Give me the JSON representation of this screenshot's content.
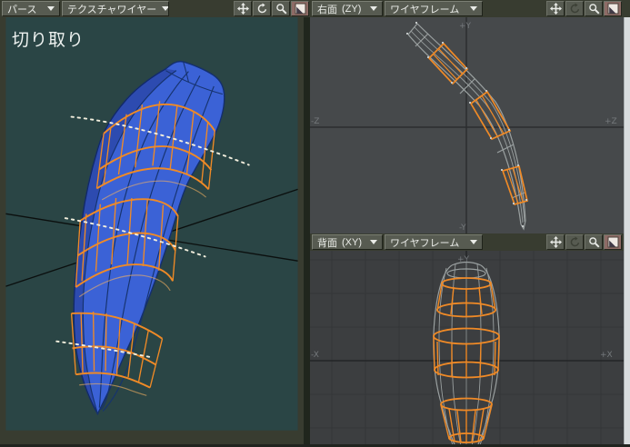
{
  "window": {
    "overlay_text": "切り取り"
  },
  "viewports": {
    "perspective": {
      "view_label": "パース",
      "display_mode": "テクスチャワイヤー"
    },
    "right": {
      "view_label": "右面",
      "axis_label": "(ZY)",
      "display_mode": "ワイヤフレーム",
      "axes": {
        "top": "+Y",
        "bottom": "-Y",
        "left": "-Z",
        "right": "+Z"
      }
    },
    "back": {
      "view_label": "背面",
      "axis_label": "(XY)",
      "display_mode": "ワイヤフレーム",
      "axes": {
        "top": "+Y",
        "left": "-X",
        "right": "+X"
      }
    }
  },
  "icons": [
    "pan-icon",
    "rotate-icon",
    "zoom-icon",
    "maximize-icon",
    "chevron-down-icon"
  ],
  "colors": {
    "selection_orange": "#f08a26",
    "model_blue": "#3b62d6",
    "model_edge_navy": "#142f6d",
    "perspective_bg": "#2a4545",
    "ortho_bg": "#46494b",
    "grid_bg": "#3c3e40",
    "header_bg": "#383c30",
    "button_bg": "#575b51",
    "maximize_button_bg": "#8e6b66",
    "wireframe_gray": "#9aa0a0",
    "cut_stroke_white": "#f2eedd"
  }
}
